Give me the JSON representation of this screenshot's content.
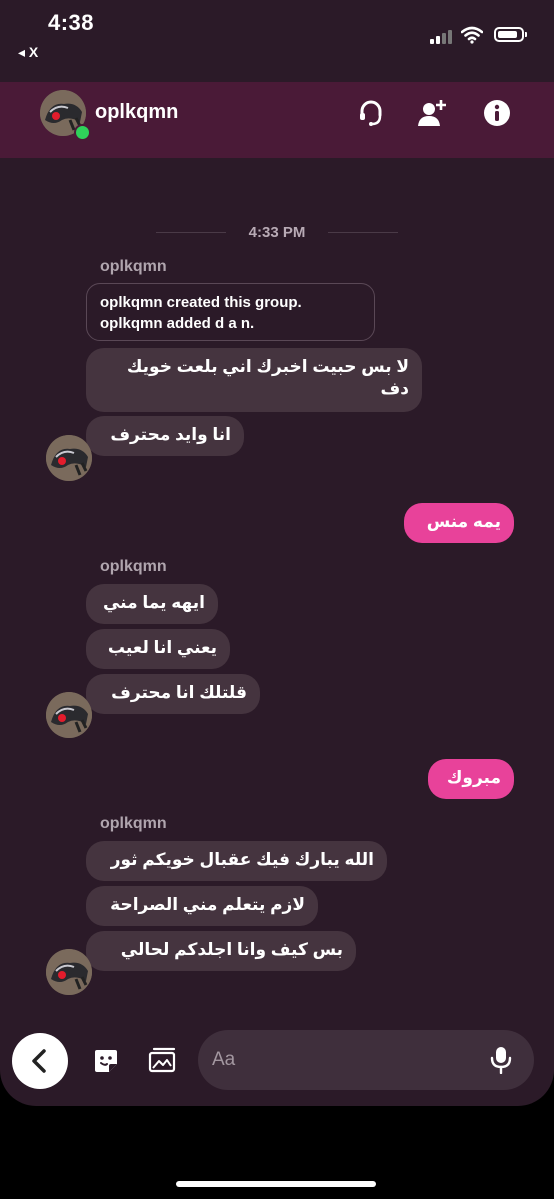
{
  "status_bar": {
    "time": "4:38",
    "back_label": "◂ X"
  },
  "header": {
    "name": "oplkqmn"
  },
  "timestamp": "4:33 PM",
  "groups": [
    {
      "sender": "oplkqmn",
      "system": [
        "oplkqmn created this group.",
        "oplkqmn added d a n."
      ],
      "messages": [
        "لا بس حبيت اخبرك اني بلعت خويك دف",
        "انا وايد محترف"
      ]
    },
    {
      "mine": "يمه منس"
    },
    {
      "sender": "oplkqmn",
      "messages": [
        "ايهه يما مني",
        "يعني انا لعيب",
        "قلتلك انا محترف"
      ]
    },
    {
      "mine": "مبروك"
    },
    {
      "sender": "oplkqmn",
      "messages": [
        "الله يبارك فيك عقبال خويكم ثور",
        "لازم يتعلم مني الصراحة",
        "بس كيف وانا اجلدكم لحالي"
      ]
    }
  ],
  "composer": {
    "placeholder": "Aa"
  },
  "icons": {
    "header": [
      "headset-icon",
      "add-person-icon",
      "info-icon"
    ],
    "composer": [
      "back-chevron-icon",
      "sticker-icon",
      "gallery-icon",
      "mic-icon"
    ]
  },
  "colors": {
    "accent": "#e8429a",
    "header": "#4a1a37",
    "background": "#2b1a28",
    "bubble": "#45343f",
    "online": "#2fd15a"
  }
}
